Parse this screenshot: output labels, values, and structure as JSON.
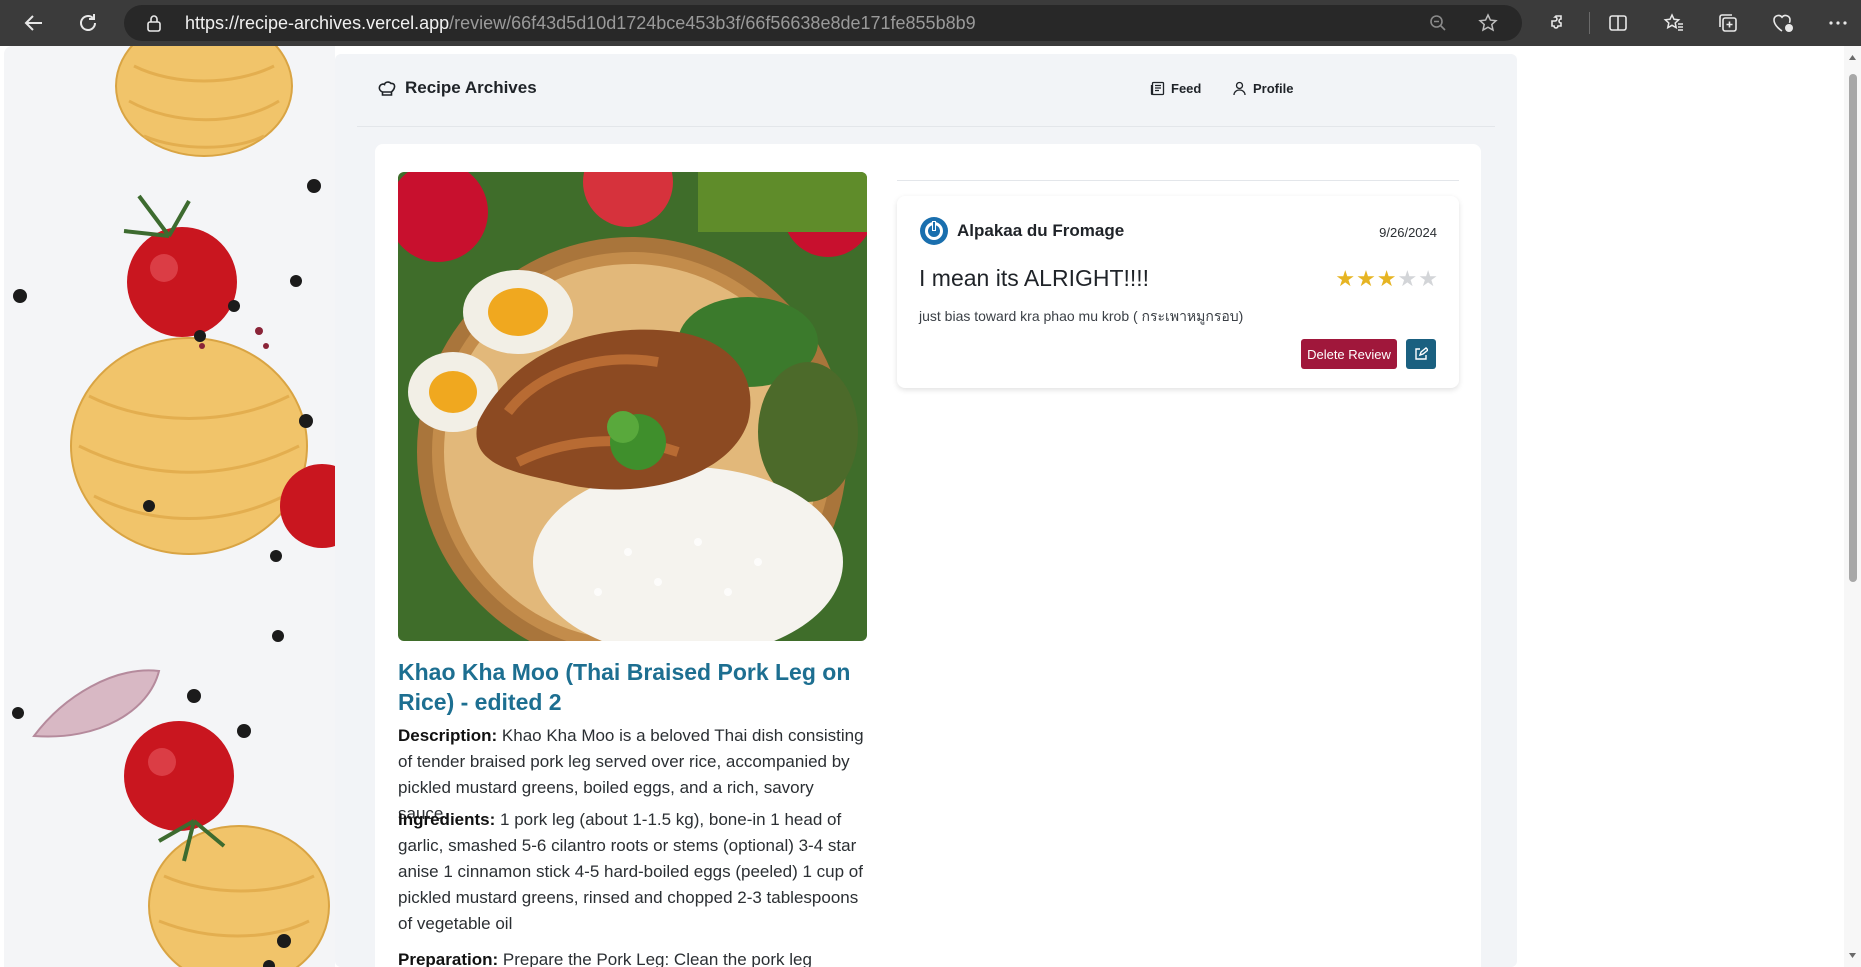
{
  "browser": {
    "url_host": "https://recipe-archives.vercel.app",
    "url_path": "/review/66f43d5d10d1724bce453b3f/66f56638e8de171fe855b8b9"
  },
  "header": {
    "brand": "Recipe Archives",
    "nav": [
      {
        "label": "Feed",
        "icon": "newspaper-icon"
      },
      {
        "label": "Profile",
        "icon": "user-icon"
      }
    ]
  },
  "recipe": {
    "title": "Khao Kha Moo (Thai Braised Pork Leg on Rice) - edited 2",
    "description_label": "Description:",
    "description": "Khao Kha Moo is a beloved Thai dish consisting of tender braised pork leg served over rice, accompanied by pickled mustard greens, boiled eggs, and a rich, savory sauce.",
    "ingredients_label": "Ingredients:",
    "ingredients": "1 pork leg (about 1-1.5 kg), bone-in 1 head of garlic, smashed 5-6 cilantro roots or stems (optional) 3-4 star anise 1 cinnamon stick 4-5 hard-boiled eggs (peeled) 1 cup of pickled mustard greens, rinsed and chopped 2-3 tablespoons of vegetable oil",
    "preparation_label": "Preparation:",
    "preparation": "Prepare the Pork Leg: Clean the pork leg"
  },
  "review": {
    "author": "Alpakaa du Fromage",
    "date": "9/26/2024",
    "title": "I mean its ALRIGHT!!!!",
    "rating": 3,
    "rating_max": 5,
    "body": "just bias toward kra phao mu krob ( กระเพาหมูกรอบ)",
    "delete_label": "Delete Review",
    "edit_icon": "edit-icon"
  },
  "colors": {
    "accent": "#1d6f91",
    "delete": "#a0173b",
    "edit": "#1a6080",
    "star": "#e6b422"
  }
}
